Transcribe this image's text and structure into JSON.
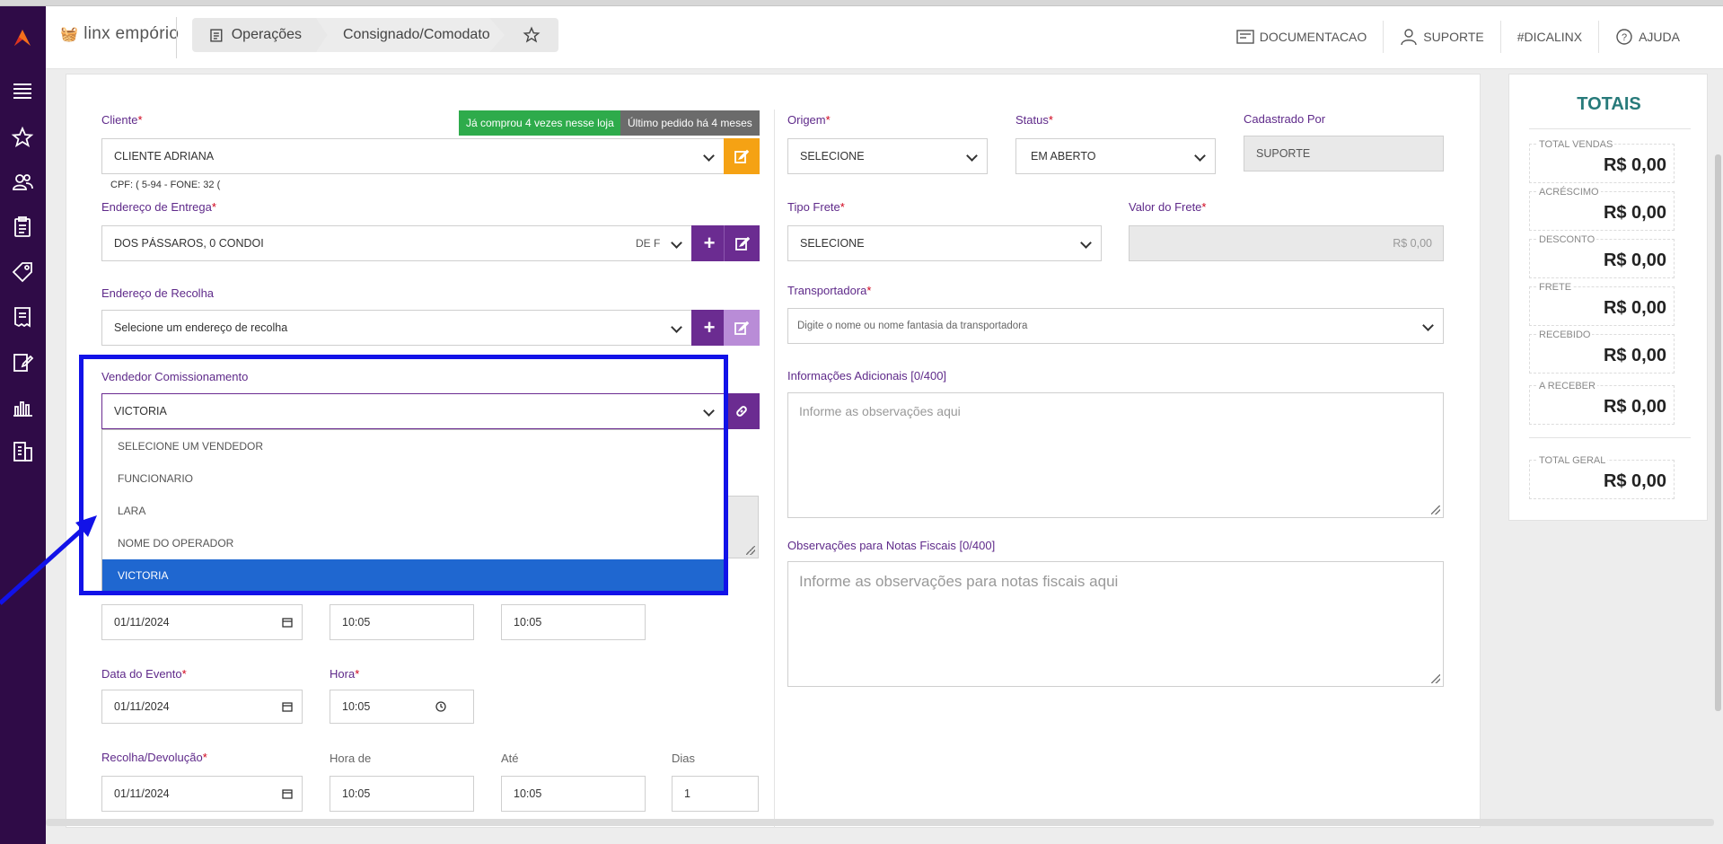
{
  "topbar": {
    "logo": "linx empório",
    "breadcrumb": [
      "Operações",
      "Consignado/Comodato"
    ],
    "nav": {
      "docs": "DOCUMENTACAO",
      "support": "SUPORTE",
      "tip": "#DICALINX",
      "help": "AJUDA"
    }
  },
  "form": {
    "cliente_label": "Cliente",
    "cliente_value": "CLIENTE ADRIANA",
    "badge_green": "Já comprou 4 vezes nesse loja",
    "badge_grey": "Último pedido há 4 meses",
    "cpf_text": "CPF: (          5-94 - FONE: 32 (",
    "endereco_entrega_label": "Endereço de Entrega",
    "endereco_entrega_value": "DOS PÁSSAROS, 0 CONDOI",
    "endereco_entrega_suffix": "DE F",
    "endereco_recolha_label": "Endereço de Recolha",
    "endereco_recolha_placeholder": "Selecione um endereço de recolha",
    "vendedor_label": "Vendedor Comissionamento",
    "vendedor_value": "VICTORIA",
    "vendedor_options": [
      "SELECIONE UM VENDEDOR",
      "FUNCIONARIO",
      "LARA",
      "NOME DO OPERADOR",
      "VICTORIA"
    ],
    "row1": {
      "date": "01/11/2024",
      "time1": "10:05",
      "time2": "10:05"
    },
    "data_evento_label": "Data do Evento",
    "data_evento_value": "01/11/2024",
    "hora_label": "Hora",
    "hora_value": "10:05",
    "recolha_label": "Recolha/Devolução",
    "recolha_value": "01/11/2024",
    "hora_de_label": "Hora de",
    "hora_de_value": "10:05",
    "ate_label": "Até",
    "ate_value": "10:05",
    "dias_label": "Dias",
    "dias_value": "1",
    "origem_label": "Origem",
    "origem_value": "SELECIONE",
    "status_label": "Status",
    "status_value": "EM ABERTO",
    "cadastrado_label": "Cadastrado Por",
    "cadastrado_value": "SUPORTE",
    "tipo_frete_label": "Tipo Frete",
    "tipo_frete_value": "SELECIONE",
    "valor_frete_label": "Valor do Frete",
    "valor_frete_value": "R$ 0,00",
    "transportadora_label": "Transportadora",
    "transportadora_placeholder": "Digite o nome ou nome fantasia da transportadora",
    "info_label": "Informações Adicionais [0/400]",
    "info_placeholder": "Informe as observações aqui",
    "obs_label": "Observações para Notas Fiscais [0/400]",
    "obs_placeholder": "Informe as observações para notas fiscais aqui"
  },
  "totais": {
    "title": "TOTAIS",
    "items": [
      {
        "label": "TOTAL VENDAS",
        "value": "R$ 0,00"
      },
      {
        "label": "ACRÉSCIMO",
        "value": "R$ 0,00"
      },
      {
        "label": "DESCONTO",
        "value": "R$ 0,00"
      },
      {
        "label": "FRETE",
        "value": "R$ 0,00"
      },
      {
        "label": "RECEBIDO",
        "value": "R$ 0,00"
      },
      {
        "label": "A RECEBER",
        "value": "R$ 0,00"
      },
      {
        "label": "TOTAL GERAL",
        "value": "R$ 0,00"
      }
    ]
  },
  "colors": {
    "sidebar": "#2f0b47",
    "purple": "#6b2c91",
    "highlight": "#1212e8",
    "selected": "#1f67d0"
  }
}
